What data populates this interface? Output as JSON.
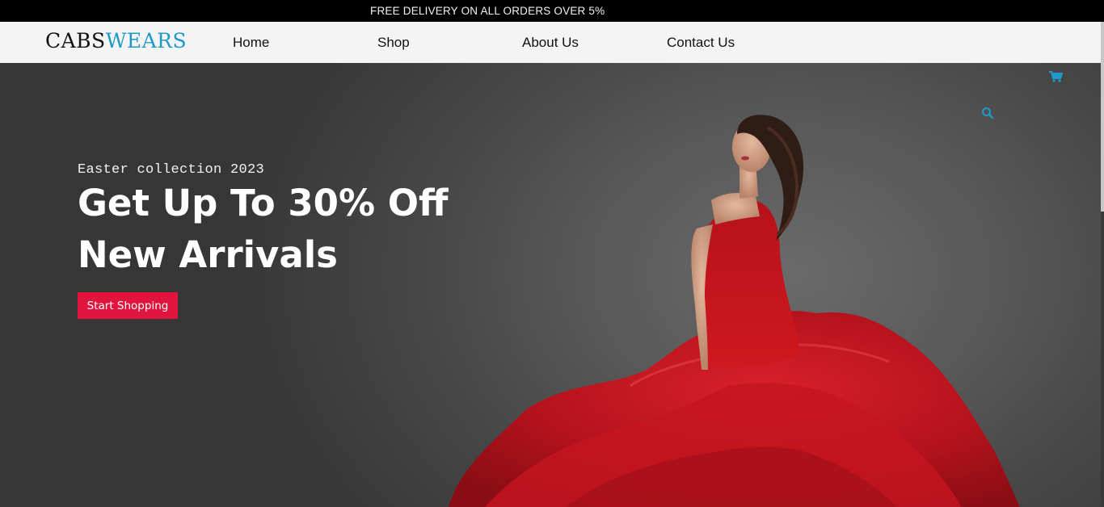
{
  "announcement": {
    "text": "FREE DELIVERY ON ALL ORDERS OVER 5%"
  },
  "header": {
    "logo_part1": "CABS",
    "logo_part2": "WEARS",
    "nav": [
      {
        "label": "Home"
      },
      {
        "label": "Shop"
      },
      {
        "label": "About Us"
      },
      {
        "label": "Contact Us"
      }
    ]
  },
  "icons": {
    "cart": "cart-icon",
    "search": "search-icon"
  },
  "hero": {
    "kicker": "Easter collection 2023",
    "title_line1": "Get Up To 30% Off",
    "title_line2": "New Arrivals",
    "cta_label": "Start Shopping"
  },
  "colors": {
    "brand_accent": "#1e9ac8",
    "cta": "#e0143c",
    "topbar_bg": "#000000",
    "navbar_bg": "#f4f4f4"
  }
}
